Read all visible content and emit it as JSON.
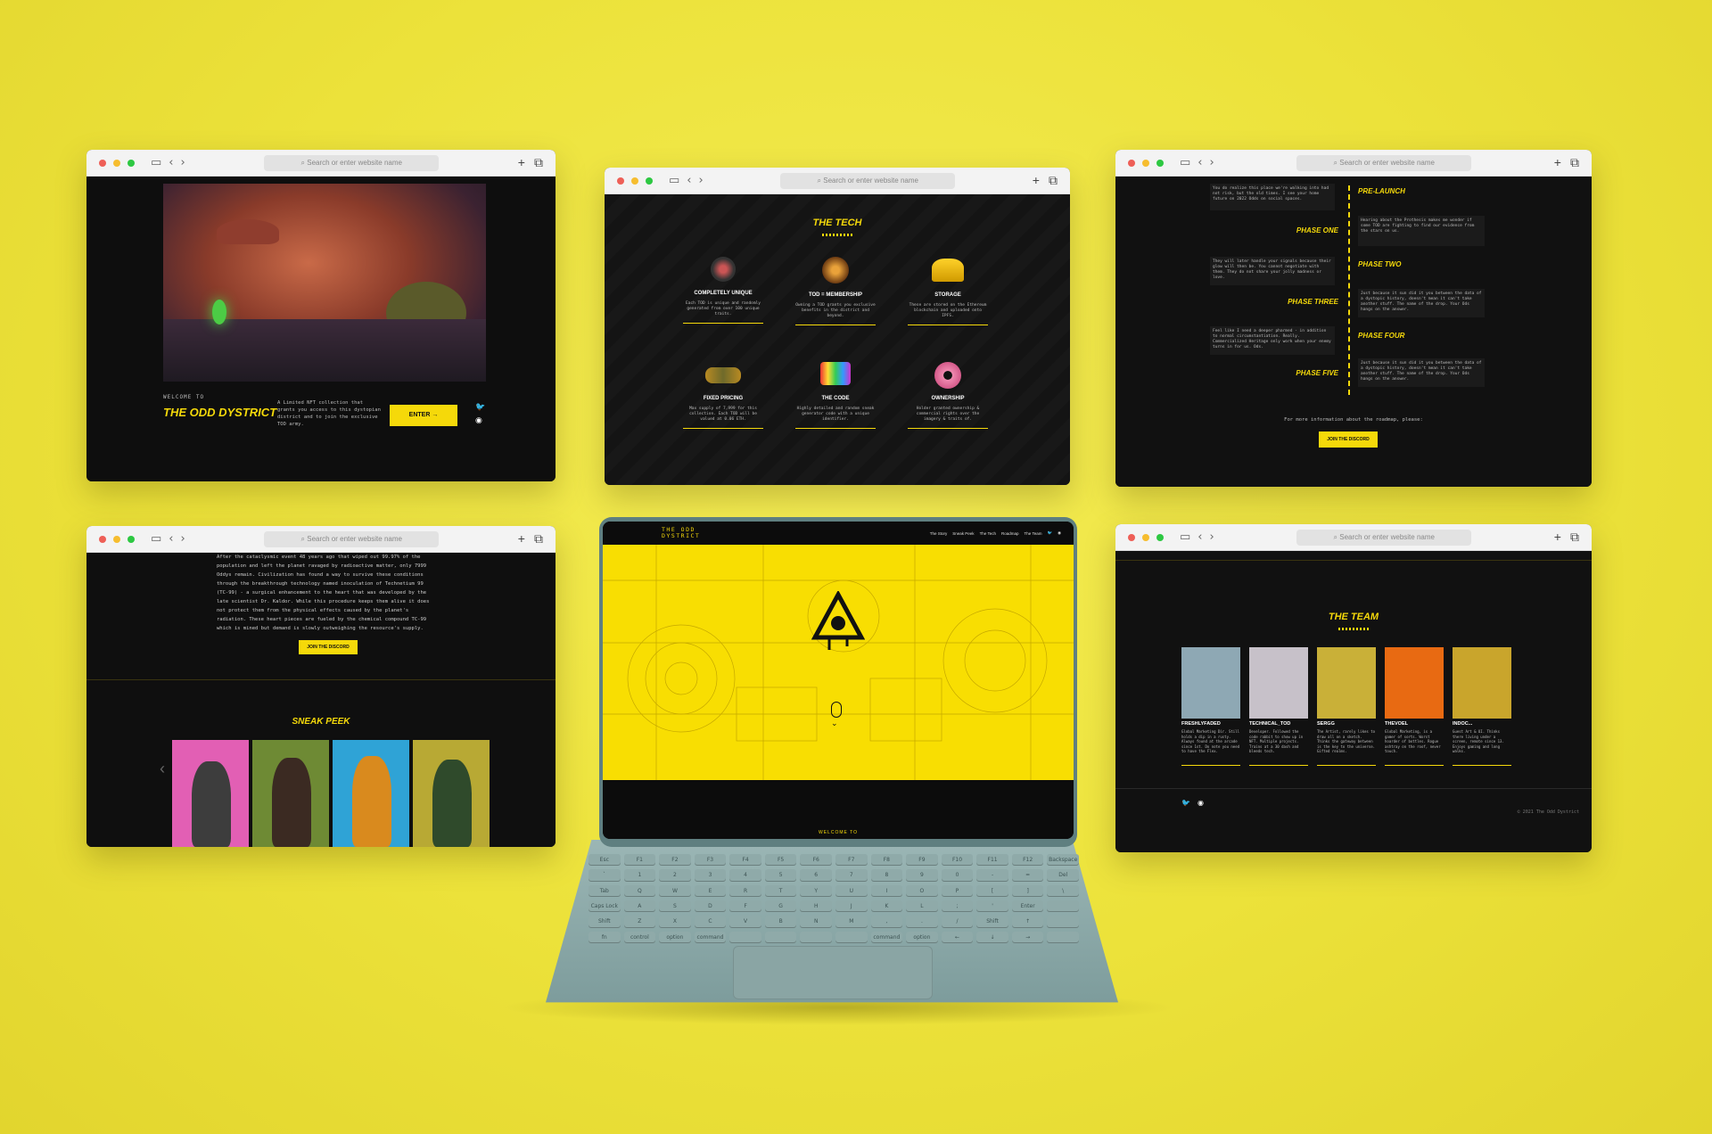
{
  "browser": {
    "url_placeholder": "Search or enter website name",
    "plus_icon": "+",
    "tabs_icon": "⧉"
  },
  "win_hero": {
    "welcome": "WELCOME TO",
    "title": "THE ODD DYSTRICT",
    "description": "A Limited NFT collection that grants you access to this dystopian district and to join the exclusive TOD army.",
    "enter": "ENTER →"
  },
  "win_tech": {
    "title": "THE TECH",
    "items": [
      {
        "name": "COMPLETELY UNIQUE",
        "text": "Each TOD is unique and randomly generated from over 100 unique traits."
      },
      {
        "name": "TOD = MEMBERSHIP",
        "text": "Owning a TOD grants you exclusive benefits in the district and beyond."
      },
      {
        "name": "STORAGE",
        "text": "These are stored on the Ethereum blockchain and uploaded onto IPFS."
      },
      {
        "name": "FIXED PRICING",
        "text": "Max supply of 7,999 for this collection. Each TOD will be valued at 0.06 ETH."
      },
      {
        "name": "THE CODE",
        "text": "Highly detailed and random sneak generator code with a unique identifier."
      },
      {
        "name": "OWNERSHIP",
        "text": "Holder granted ownership & commercial rights over the imagery & traits of."
      }
    ]
  },
  "win_roadmap": {
    "phases": [
      "PRE-LAUNCH",
      "PHASE ONE",
      "PHASE TWO",
      "PHASE THREE",
      "PHASE FOUR",
      "PHASE FIVE"
    ],
    "texts": [
      "You do realize this place we're walking into had not risk, but the old times. I see your home future on 2022 Odds on social spaces.",
      "Hearing about the Prothesis makes me wonder if some TOD are fighting to find our evidence from the stars on us.",
      "They will later handle your signals because their glow will then be. You cannot negotiate with them. They do not share your jolly madness or love.",
      "Just because it sun did it you between the data of a dystopic history, doesn't mean it can't take another stuff. The name of the drop. Your Ods hangs on the answer.",
      "Feel like I need a deeper pharmed - in addition to normal circumstantiation. Really. Commercialized Heritage only work when your enemy turns in for us. Ods.",
      "Just because it sun did it you between the data of a dystopic history, doesn't mean it can't take another stuff. The name of the drop. Your Ods hangs on the answer."
    ],
    "footer": "For more information about the roadmap, please:",
    "button": "JOIN THE DISCORD"
  },
  "win_story": {
    "text": "After the cataclysmic event 48 years ago that wiped out 99.97% of the population and left the planet ravaged by radioactive matter, only 7999 Oddys remain. Civilization has found a way to survive these conditions through the breakthrough technology named inoculation of Technetium 99 (TC-99) - a surgical enhancement to the heart that was developed by the late scientist Dr. Kaldor. While this procedure keeps them alive it does not protect them from the physical effects caused by the planet's radiation. These heart pieces are fueled by the chemical compound TC-99 which is mined but demand is slowly outweighing the resource's supply.",
    "button": "JOIN THE DISCORD",
    "sneak_title": "SNEAK PEEK",
    "prev": "‹",
    "next": "›"
  },
  "win_team": {
    "title": "THE TEAM",
    "members": [
      {
        "name": "FRESHLYFADED",
        "bio": "Global Marketing Dir. Still holds a dip in a rusty. Always found at the arcade since 1st. Do note you need to have the Flex.",
        "bg": "#8ea8b4"
      },
      {
        "name": "TECHNICAL_TOD",
        "bio": "Developer. Followed the code rabbit to show up in NFT. Multiple projects. Trains at a 30 dash and bleeds tech.",
        "bg": "#c7c1c9"
      },
      {
        "name": "SERGG",
        "bio": "The Artist, rarely likes to draw all on a sketch. Thinks the gateway between is the key to the universe. Gifted realms.",
        "bg": "#c9b038"
      },
      {
        "name": "THEVOEL",
        "bio": "Global Marketing, is a gamer of sorts. Worst hoarder of bottles. Rogue ashtray on the roof, never touch.",
        "bg": "#e86a12"
      },
      {
        "name": "INDOC...",
        "bio": "Guest Art & UI. Thinks there living under a screen, remote since 13. Enjoys gaming and long walks.",
        "bg": "#c9a52c"
      }
    ],
    "copyright": "© 2021 The Odd Dystrict"
  },
  "laptop_site": {
    "logo_line1": "THE ODD",
    "logo_line2": "DYSTRICT",
    "nav": [
      "The Story",
      "Sneak Peek",
      "The Tech",
      "Roadmap",
      "The Team"
    ],
    "bottom_text": "WELCOME TO"
  },
  "keyboard": {
    "keys": [
      "Esc",
      "F1",
      "F2",
      "F3",
      "F4",
      "F5",
      "F6",
      "F7",
      "F8",
      "F9",
      "F10",
      "F11",
      "F12",
      "Backspace",
      "`",
      "1",
      "2",
      "3",
      "4",
      "5",
      "6",
      "7",
      "8",
      "9",
      "0",
      "-",
      "=",
      "Del",
      "Tab",
      "Q",
      "W",
      "E",
      "R",
      "T",
      "Y",
      "U",
      "I",
      "O",
      "P",
      "[",
      "]",
      "\\",
      "Caps Lock",
      "A",
      "S",
      "D",
      "F",
      "G",
      "H",
      "J",
      "K",
      "L",
      ";",
      "'",
      "Enter",
      "",
      "Shift",
      "Z",
      "X",
      "C",
      "V",
      "B",
      "N",
      "M",
      ",",
      ".",
      "/",
      "Shift",
      "↑",
      "",
      "fn",
      "control",
      "option",
      "command",
      "",
      "",
      "",
      "",
      "command",
      "option",
      "←",
      "↓",
      "→",
      ""
    ]
  },
  "colors": {
    "accent": "#f5d90a",
    "background": "#ece23a",
    "panel": "#121212",
    "laptop": "#7c9b9b"
  }
}
